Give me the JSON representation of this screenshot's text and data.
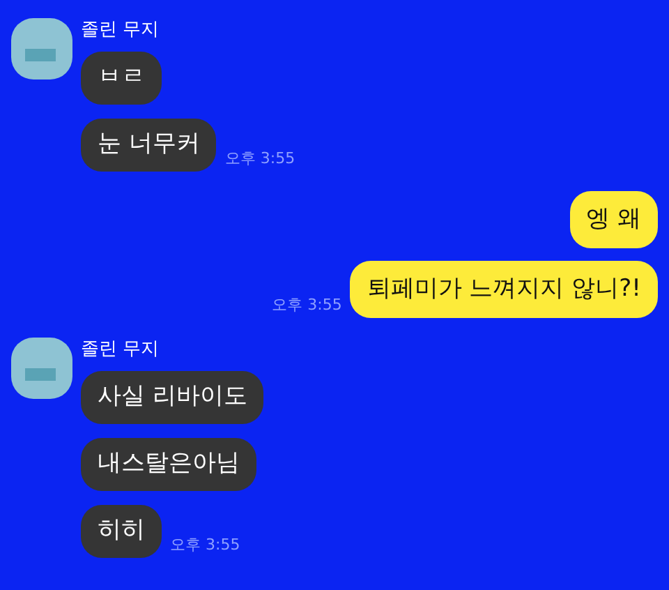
{
  "groups": [
    {
      "kind": "received",
      "sender": "졸린 무지",
      "messages": [
        "ㅂㄹ",
        "눈 너무커"
      ],
      "time": "오후 3:55"
    },
    {
      "kind": "sent",
      "messages": [
        "엥 왜",
        "퇴페미가 느껴지지 않니?!"
      ],
      "time": "오후 3:55"
    },
    {
      "kind": "received",
      "sender": "졸린 무지",
      "messages": [
        "사실 리바이도",
        "내스탈은아님",
        "히히"
      ],
      "time": "오후 3:55"
    }
  ]
}
